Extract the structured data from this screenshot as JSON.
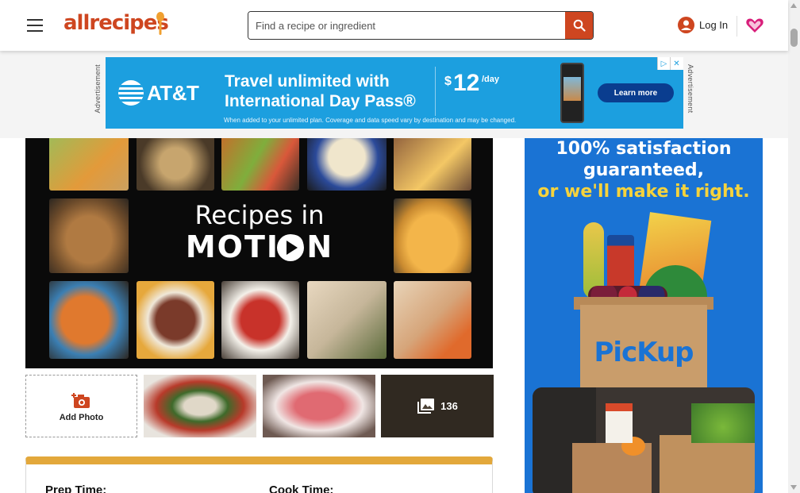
{
  "header": {
    "menu_icon": "hamburger-menu-icon",
    "logo_text": "allrecipes",
    "search": {
      "placeholder": "Find a recipe or ingredient",
      "value": "",
      "button_icon": "search-icon"
    },
    "login_label": "Log In",
    "login_icon": "user-circle-icon",
    "saved_icon": "heart-icon",
    "colors": {
      "brand": "#ce4620",
      "heart": "#d81e7a"
    }
  },
  "ad_label": "Advertisement",
  "top_ad": {
    "brand": "AT&T",
    "headline": "Travel unlimited with International Day Pass®",
    "price_symbol": "$",
    "price": "12",
    "price_unit": "/day",
    "cta": "Learn more",
    "fine_print": "When added to your unlimited plan. Coverage and data speed vary by destination and may be changed.",
    "background_color": "#1c9fdf"
  },
  "hero_video": {
    "title_line1": "Recipes in",
    "title_line2": "MOTION",
    "play_icon": "play-icon"
  },
  "photos": {
    "add_photo_label": "Add Photo",
    "add_photo_icon": "camera-add-icon",
    "gallery_icon": "image-gallery-icon",
    "count": "136"
  },
  "recipe_details": {
    "prep_label": "Prep Time:",
    "cook_label": "Cook Time:",
    "accent_color": "#e3a83b"
  },
  "side_ad": {
    "line1": "100% satisfaction",
    "line2": "guaranteed,",
    "line3": "or we'll make it right.",
    "pickup_text": "PicKup",
    "background_color": "#1a73d4"
  }
}
